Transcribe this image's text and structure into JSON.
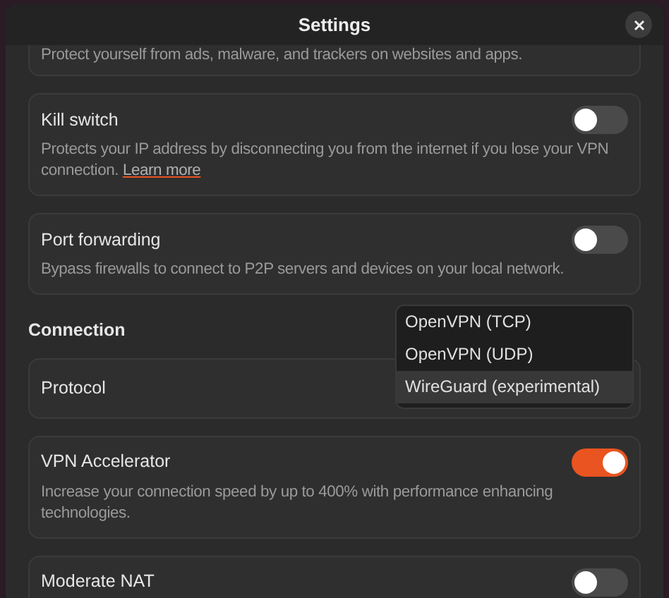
{
  "window": {
    "title": "Settings"
  },
  "top_description": "Protect yourself from ads, malware, and trackers on websites and apps.",
  "features": [
    {
      "title": "Kill switch",
      "on": false,
      "description": "Protects your IP address by disconnecting you from the internet if you lose your VPN connection.",
      "link": "Learn more"
    },
    {
      "title": "Port forwarding",
      "on": false,
      "description": "Bypass firewalls to connect to P2P servers and devices on your local network."
    }
  ],
  "connection": {
    "heading": "Connection",
    "protocol": {
      "label": "Protocol",
      "options": [
        {
          "label": "OpenVPN (TCP)",
          "selected": false
        },
        {
          "label": "OpenVPN (UDP)",
          "selected": false
        },
        {
          "label": "WireGuard (experimental)",
          "selected": true
        }
      ]
    },
    "features": [
      {
        "title": "VPN Accelerator",
        "on": true,
        "description": "Increase your connection speed by up to 400% with performance enhancing technologies."
      },
      {
        "title": "Moderate NAT",
        "on": false
      }
    ]
  }
}
